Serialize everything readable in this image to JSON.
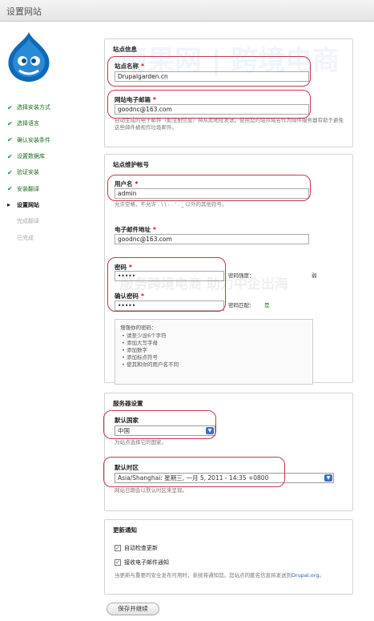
{
  "window": {
    "title": "设置网站"
  },
  "steps": [
    {
      "label": "选择安装方式",
      "state": "done"
    },
    {
      "label": "选择语言",
      "state": "done"
    },
    {
      "label": "确认安装条件",
      "state": "done"
    },
    {
      "label": "设置数据库",
      "state": "done"
    },
    {
      "label": "验证安装",
      "state": "done"
    },
    {
      "label": "安装翻译",
      "state": "done"
    },
    {
      "label": "设置网站",
      "state": "active"
    },
    {
      "label": "完成翻译",
      "state": "todo"
    },
    {
      "label": "已完成",
      "state": "todo"
    }
  ],
  "site_info": {
    "legend": "站点信息",
    "name_label": "站点名称",
    "name_value": "Drupalgarden.cn",
    "email_label": "网站电子邮箱",
    "email_value": "goodnc@163.com",
    "email_desc": "自动生成的电子邮件（如注册信息）将从此地址发送。使用您的站点域名作为邮件服务器有助于避免这些邮件被视作垃圾邮件。"
  },
  "admin": {
    "legend": "站点维护帐号",
    "user_label": "用户名",
    "user_value": "admin",
    "user_desc": "允许空格，不允许 . \\ \\ - . ' . _ 以外的其他符号。",
    "email_label": "电子邮件地址",
    "email_value": "goodnc@163.com",
    "pass_label": "密码",
    "pass_value": "•••••",
    "strength_label": "密码强度：",
    "strength_value": "弱",
    "confirm_label": "确认密码",
    "confirm_value": "•••••",
    "match_label": "密码匹配：",
    "match_value": "是",
    "tips_title": "增强你的密码：",
    "tips": [
      "请至少设6个字符",
      "添加大写字母",
      "添加数字",
      "添加标点符号",
      "使其和你的用户名不同"
    ]
  },
  "server": {
    "legend": "服务器设置",
    "country_label": "默认国家",
    "country_value": "中国",
    "country_desc": "为站点选择它的国家。",
    "tz_label": "默认时区",
    "tz_value": "Asia/Shanghai: 星期三, 一月 5, 2011 - 14:35 +0800",
    "tz_desc": "网站日期会以默认时区来呈现。"
  },
  "updates": {
    "legend": "更新通知",
    "check_label": "自动检查更新",
    "mail_label": "接收电子邮件通知",
    "desc": "当更新与重要的安全发布可用时，系统将通知您。您站点的匿名信息将发送到",
    "link": "Drupal.org",
    "desc_end": "。"
  },
  "submit_label": "保存并继续",
  "watermark": {
    "brand": "雨果网 | 跨境电商",
    "slogan": "服务跨境电商 助力中企出海"
  },
  "colors": {
    "highlight": "#c8384a",
    "done": "#1f6b1f",
    "link": "#2a5db0"
  }
}
